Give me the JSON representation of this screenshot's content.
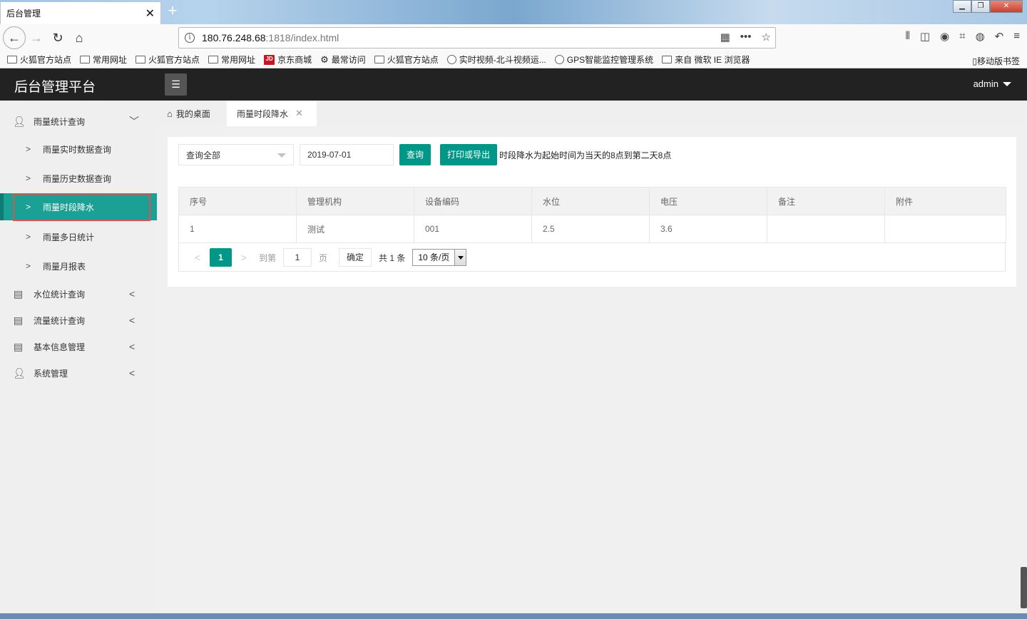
{
  "browser": {
    "tab_title": "后台管理",
    "tab_close": "✕",
    "new_tab": "+",
    "url_host": "180.76.248.68",
    "url_rest": ":1818/index.html",
    "bookmarks": [
      {
        "label": "火狐官方站点",
        "icon": "folder-icon"
      },
      {
        "label": "常用网址",
        "icon": "folder-icon"
      },
      {
        "label": "火狐官方站点",
        "icon": "folder-icon"
      },
      {
        "label": "常用网址",
        "icon": "folder-icon"
      },
      {
        "label": "京东商城",
        "icon": "jd-icon"
      },
      {
        "label": "最常访问",
        "icon": "gear-icon"
      },
      {
        "label": "火狐官方站点",
        "icon": "folder-icon"
      },
      {
        "label": "实时视频-北斗视频运...",
        "icon": "globe-icon"
      },
      {
        "label": "GPS智能监控管理系统",
        "icon": "globe-icon"
      },
      {
        "label": "来自 微软 IE 浏览器",
        "icon": "folder-icon"
      }
    ],
    "mobile_bookmarks": "移动版书签"
  },
  "app": {
    "title": "后台管理平台",
    "user": "admin"
  },
  "sidebar": {
    "groups": [
      {
        "label": "雨量统计查询",
        "icon": "user-icon",
        "expanded": true
      },
      {
        "label": "水位统计查询",
        "icon": "document-icon",
        "expanded": false
      },
      {
        "label": "流量统计查询",
        "icon": "document-icon",
        "expanded": false
      },
      {
        "label": "基本信息管理",
        "icon": "document-icon",
        "expanded": false
      },
      {
        "label": "系统管理",
        "icon": "user-icon",
        "expanded": false
      }
    ],
    "sub_items": [
      {
        "label": "雨量实时数据查询"
      },
      {
        "label": "雨量历史数据查询"
      },
      {
        "label": "雨量时段降水",
        "active": true
      },
      {
        "label": "雨量多日统计"
      },
      {
        "label": "雨量月报表"
      }
    ]
  },
  "tabs": {
    "home": "我的桌面",
    "current": "雨量时段降水"
  },
  "filters": {
    "select_value": "查询全部",
    "date_value": "2019-07-01",
    "query_button": "查询",
    "print_button": "打印或导出",
    "hint": "时段降水为起始时间为当天的8点到第二天8点"
  },
  "table": {
    "columns": [
      "序号",
      "管理机构",
      "设备编码",
      "水位",
      "电压",
      "备注",
      "附件"
    ],
    "rows": [
      [
        "1",
        "测试",
        "001",
        "2.5",
        "3.6",
        "",
        ""
      ]
    ]
  },
  "pager": {
    "current_page": "1",
    "goto_label": "到第",
    "goto_value": "1",
    "page_label": "页",
    "ok_button": "确定",
    "total": "共 1 条",
    "page_size": "10 条/页"
  },
  "colors": {
    "accent": "#009688",
    "sidebar_active": "#1aa094",
    "header_bg": "#222222"
  }
}
